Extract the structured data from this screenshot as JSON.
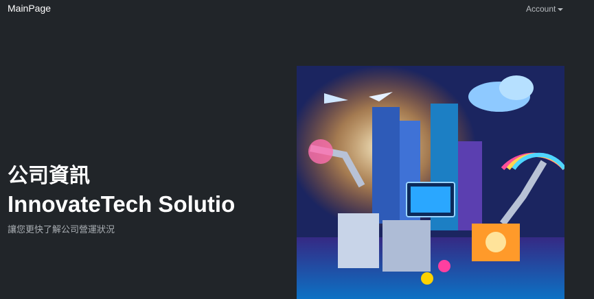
{
  "navbar": {
    "brand": "MainPage",
    "account_label": "Account"
  },
  "hero": {
    "title_cn": "公司資訊",
    "title_en": "InnovateTech Solutio",
    "subtitle": "讓您更快了解公司營運狀況"
  },
  "image": {
    "alt": "futuristic-tech-illustration"
  }
}
